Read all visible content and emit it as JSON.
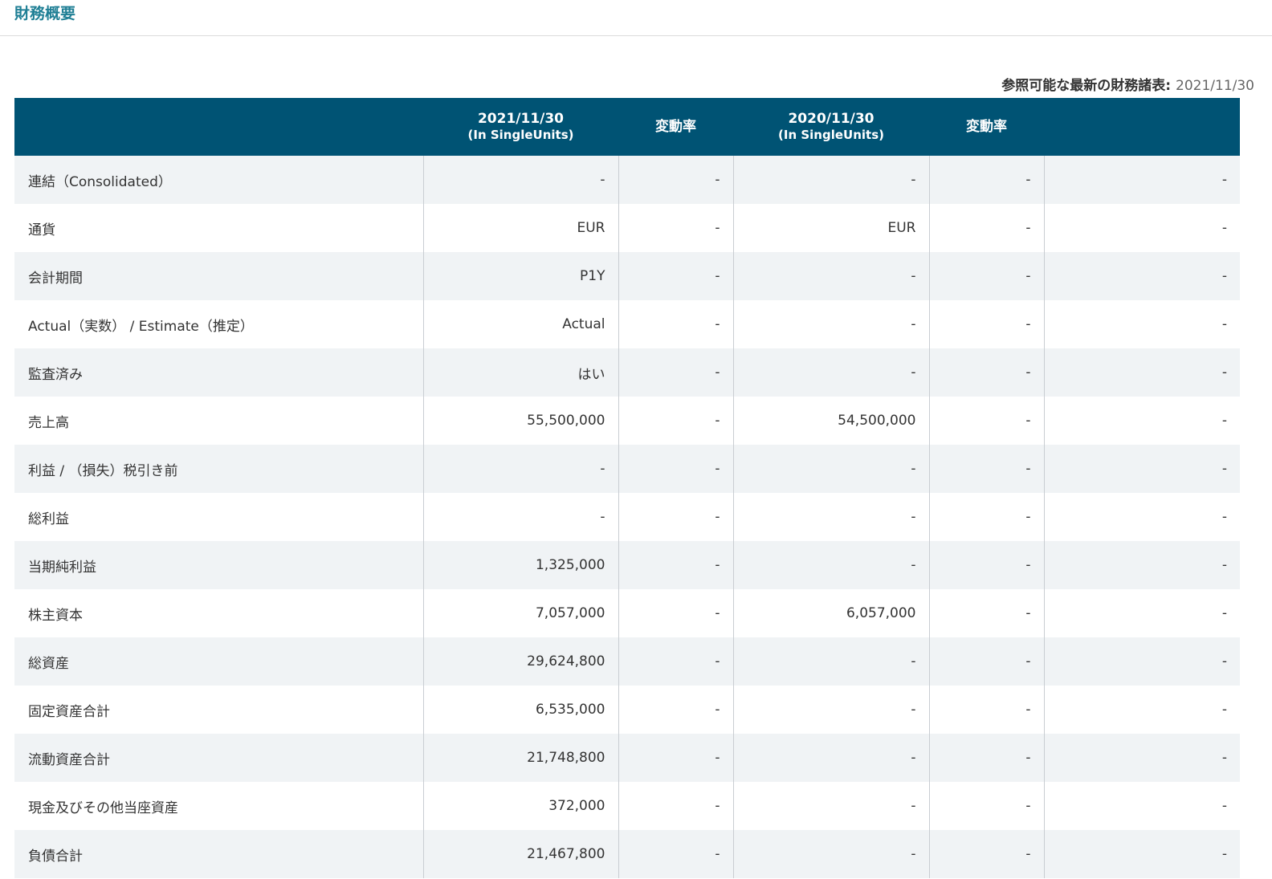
{
  "page": {
    "title": "財務概要",
    "latest_label": "参照可能な最新の財務諸表:",
    "latest_date": "2021/11/30"
  },
  "table": {
    "headers": [
      {
        "line1": "",
        "line2": ""
      },
      {
        "line1": "2021/11/30",
        "line2": "(In SingleUnits)"
      },
      {
        "line1": "変動率",
        "line2": ""
      },
      {
        "line1": "2020/11/30",
        "line2": "(In SingleUnits)"
      },
      {
        "line1": "変動率",
        "line2": ""
      },
      {
        "line1": "",
        "line2": ""
      }
    ],
    "rows": [
      {
        "label": "連結（Consolidated）",
        "cells": [
          "-",
          "-",
          "-",
          "-",
          "-"
        ]
      },
      {
        "label": "通貨",
        "cells": [
          "EUR",
          "-",
          "EUR",
          "-",
          "-"
        ]
      },
      {
        "label": "会計期間",
        "cells": [
          "P1Y",
          "-",
          "-",
          "-",
          "-"
        ]
      },
      {
        "label": "Actual（実数） / Estimate（推定）",
        "cells": [
          "Actual",
          "-",
          "-",
          "-",
          "-"
        ]
      },
      {
        "label": "監査済み",
        "cells": [
          "はい",
          "-",
          "-",
          "-",
          "-"
        ]
      },
      {
        "label": "売上高",
        "cells": [
          "55,500,000",
          "-",
          "54,500,000",
          "-",
          "-"
        ]
      },
      {
        "label": "利益 / （損失）税引き前",
        "cells": [
          "-",
          "-",
          "-",
          "-",
          "-"
        ]
      },
      {
        "label": "総利益",
        "cells": [
          "-",
          "-",
          "-",
          "-",
          "-"
        ]
      },
      {
        "label": "当期純利益",
        "cells": [
          "1,325,000",
          "-",
          "-",
          "-",
          "-"
        ]
      },
      {
        "label": "株主資本",
        "cells": [
          "7,057,000",
          "-",
          "6,057,000",
          "-",
          "-"
        ]
      },
      {
        "label": "総資産",
        "cells": [
          "29,624,800",
          "-",
          "-",
          "-",
          "-"
        ]
      },
      {
        "label": "固定資産合計",
        "cells": [
          "6,535,000",
          "-",
          "-",
          "-",
          "-"
        ]
      },
      {
        "label": "流動資産合計",
        "cells": [
          "21,748,800",
          "-",
          "-",
          "-",
          "-"
        ]
      },
      {
        "label": "現金及びその他当座資産",
        "cells": [
          "372,000",
          "-",
          "-",
          "-",
          "-"
        ]
      },
      {
        "label": "負債合計",
        "cells": [
          "21,467,800",
          "-",
          "-",
          "-",
          "-"
        ]
      }
    ]
  }
}
